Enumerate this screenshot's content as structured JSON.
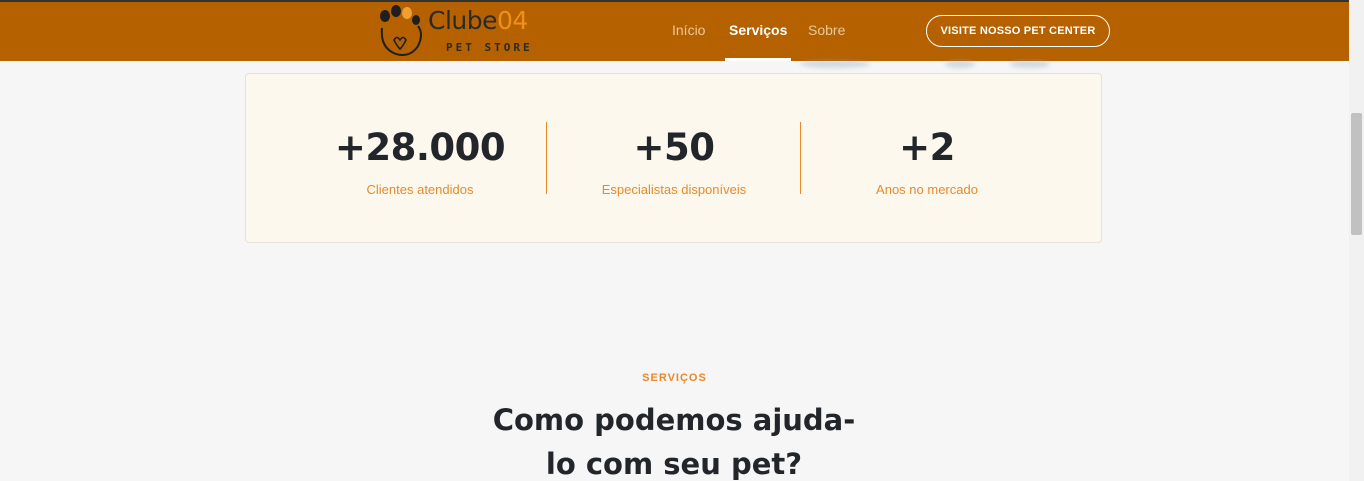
{
  "header": {
    "logo": {
      "word": "Clube",
      "number": "04",
      "sub": "PET STORE"
    },
    "nav": [
      {
        "label": "Início",
        "active": false
      },
      {
        "label": "Serviços",
        "active": true
      },
      {
        "label": "Sobre",
        "active": false
      }
    ],
    "cta_label": "VISITE NOSSO PET CENTER"
  },
  "stats": [
    {
      "value": "+28.000",
      "label": "Clientes atendidos"
    },
    {
      "value": "+50",
      "label": "Especialistas disponíveis"
    },
    {
      "value": "+2",
      "label": "Anos no mercado"
    }
  ],
  "services": {
    "tag": "SERVIÇOS",
    "title_line1": "Como podemos ajuda-",
    "title_line2": "lo com seu pet?"
  },
  "colors": {
    "header_bg": "#b56100",
    "accent": "#e8892a",
    "card_bg": "#fdf8ee",
    "text_dark": "#22262b"
  }
}
